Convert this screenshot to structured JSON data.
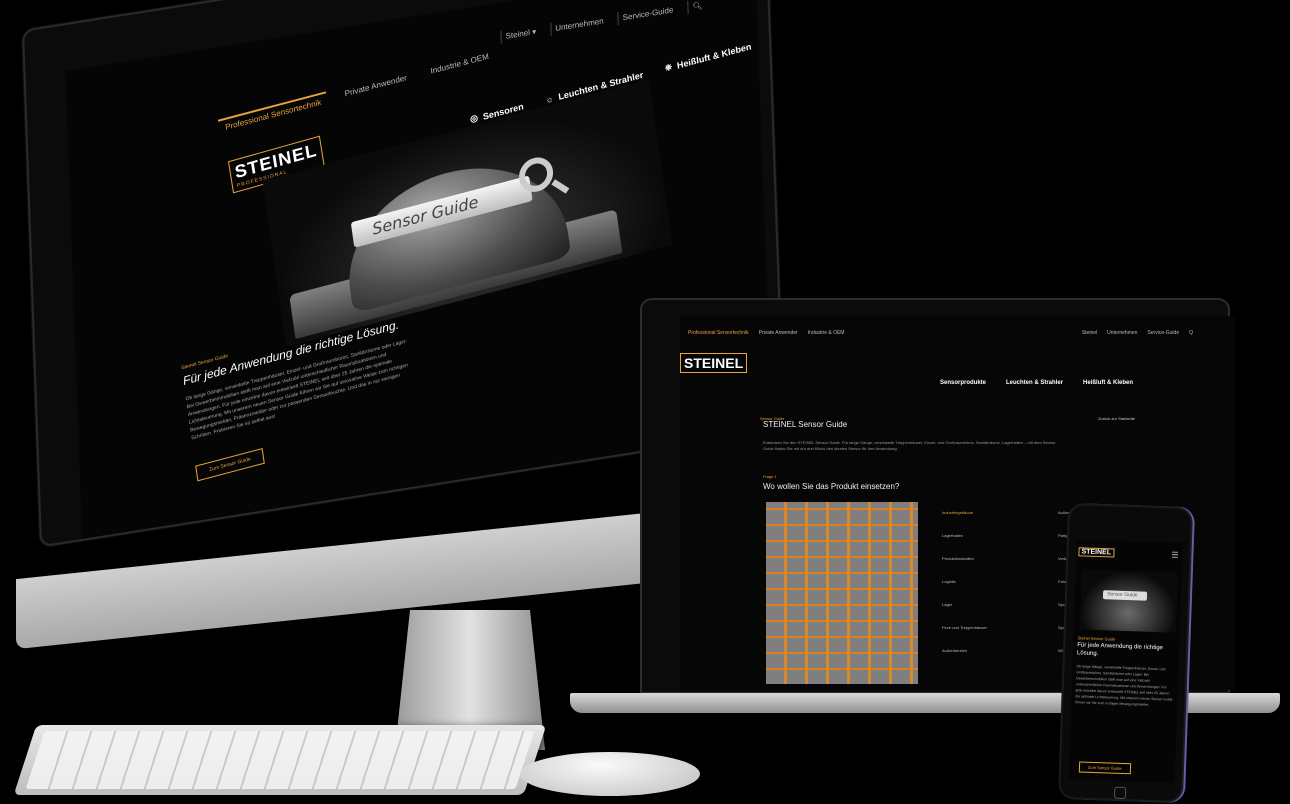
{
  "imac": {
    "util_nav": [
      "Steinel ▾",
      "Unternehmen",
      "Service-Guide"
    ],
    "top_tabs": [
      "Professional Sensortechnik",
      "Private Anwender",
      "Industrie & OEM"
    ],
    "brand": "STEINEL",
    "brand_sub": "PROFESSIONAL",
    "main_nav": [
      "Sensoren",
      "Leuchten & Strahler",
      "Heißluft & Kleben"
    ],
    "hero_search_text": "Sensor Guide",
    "kicker": "Steinel Sensor Guide",
    "headline": "Für jede Anwendung die richtige Lösung.",
    "body": "Ob lange Gänge, verwinkelte Treppenhäuser, Einzel- und Großraumbüros, Sanitärräume oder Lager: Bei Gewerbeimmobilien stellt man auf eine Vielzahl unterschiedlicher Raumsituationen und Anwendungen. Für jede einzelne davon entwickelt STEINEL seit über 25 Jahren die optimale Lichtsteuerung. Mit unserem neuen Sensor Guide führen wir Sie auf innovative Weise zum richtigen Bewegungsmelder, Präsenzmelder oder zur passenden Sensorleuchte. Und das in nur wenigen Schritten. Probieren Sie es selbst aus!",
    "cta": "Zum Sensor Guide"
  },
  "laptop": {
    "top_tabs": [
      "Professional Sensortechnik",
      "Private Anwender",
      "Industrie & OEM"
    ],
    "util_nav": [
      "Steinel",
      "Unternehmen",
      "Service-Guide",
      "Q"
    ],
    "brand": "STEINEL",
    "main_nav": [
      "Sensorprodukte",
      "Leuchten & Strahler",
      "Heißluft & Kleben"
    ],
    "page_kicker": "Sensor Guide",
    "page_title": "STEINEL Sensor Guide",
    "back_link": "Zurück zur Startseite",
    "description": "Entdecken Sie den STEINEL Sensor Guide. Für lange Gänge, verwinkelte Treppenhäuser, Einzel- und Großraumbüros, Sanitärräume, Lagerhallen – mit dem Sensor Guide finden Sie mit nur drei Klicks den idealen Sensor für Ihre Anwendung.",
    "question_kicker": "Frage 1",
    "question": "Wo wollen Sie das Produkt einsetzen?",
    "col_left": [
      "Industriegebäude",
      "Lagerhallen",
      "Produktionshallen",
      "Logistik",
      "Lager",
      "Flure und Treppenhäuser",
      "Außenbereich"
    ],
    "col_left_selected_index": 0,
    "col_right": [
      "Außenbereich",
      "Parkplatz",
      "Verkehrsflächen",
      "Fahrradstellplatz",
      "Sportanlagen",
      "Sporthalle",
      "WC/Waschräume"
    ]
  },
  "phone": {
    "brand": "STEINEL",
    "hero_search_text": "Sensor Guide",
    "kicker": "Steinel Sensor Guide",
    "headline": "Für jede Anwendung die richtige Lösung.",
    "body": "Ob lange Gänge, verwinkelte Treppenhäuser, Einzel- und Großraumbüros, Sanitärräume oder Lager: Bei Gewerbeimmobilien stellt man auf eine Vielzahl unterschiedlicher Raumsituationen und Anwendungen. Für jede einzelne davon entwickelt STEINEL seit über 25 Jahren die optimale Lichtsteuerung. Mit unserem neuen Sensor Guide führen wir Sie zum richtigen Bewegungsmelder.",
    "cta": "Zum Sensor Guide"
  },
  "colors": {
    "accent": "#e8a33d",
    "background": "#000000"
  }
}
